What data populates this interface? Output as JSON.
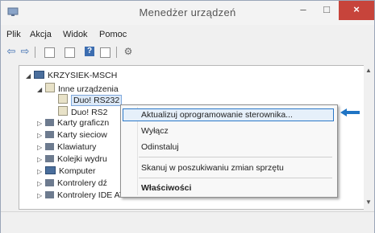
{
  "window": {
    "title": "Menedżer urządzeń",
    "buttons": {
      "minimize": "–",
      "maximize": "□",
      "close": "×"
    }
  },
  "menubar": {
    "items": [
      "Plik",
      "Akcja",
      "Widok",
      "Pomoc"
    ]
  },
  "toolbar": {
    "icons": [
      "back-icon",
      "forward-icon",
      "properties-icon",
      "console-icon",
      "help-icon",
      "show-hide-icon",
      "scan-hardware-icon"
    ],
    "glyphs": {
      "back": "⇦",
      "forward": "⇨",
      "help": "?",
      "scan": "⚙"
    }
  },
  "tree": {
    "root": "KRZYSIEK-MSCH",
    "other_devices": "Inne urządzenia",
    "device1": "Duo! RS232",
    "device2": "Duo! RS2",
    "graphics": "Karty graficzn",
    "network": "Karty sieciow",
    "keyboards": "Klawiatury",
    "queues": "Kolejki wydru",
    "computer": "Komputer",
    "audio": "Kontrolery dź",
    "ide": "Kontrolery IDE ATA/ATAPI"
  },
  "context_menu": {
    "update_driver": "Aktualizuj oprogramowanie sterownika...",
    "disable": "Wyłącz",
    "uninstall": "Odinstaluj",
    "scan_changes": "Skanuj w poszukiwaniu zmian sprzętu",
    "properties": "Właściwości"
  },
  "colors": {
    "highlight": "#2c78c8",
    "arrow": "#1f74c4",
    "close": "#c7443b"
  }
}
